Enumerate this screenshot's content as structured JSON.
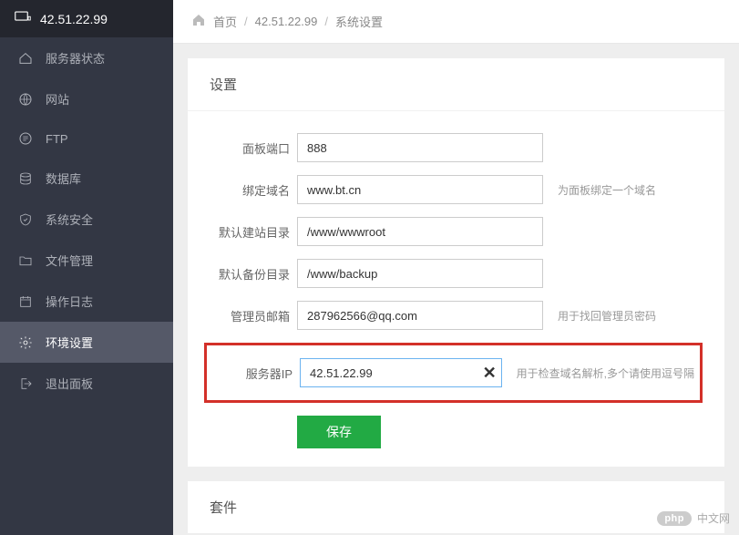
{
  "sidebar": {
    "header": {
      "ip": "42.51.22.99"
    },
    "items": [
      {
        "label": "服务器状态"
      },
      {
        "label": "网站"
      },
      {
        "label": "FTP"
      },
      {
        "label": "数据库"
      },
      {
        "label": "系统安全"
      },
      {
        "label": "文件管理"
      },
      {
        "label": "操作日志"
      },
      {
        "label": "环境设置"
      },
      {
        "label": "退出面板"
      }
    ]
  },
  "breadcrumb": {
    "home": "首页",
    "ip": "42.51.22.99",
    "current": "系统设置"
  },
  "settings": {
    "title": "设置",
    "fields": {
      "port": {
        "label": "面板端口",
        "value": "888"
      },
      "domain": {
        "label": "绑定域名",
        "value": "www.bt.cn",
        "hint": "为面板绑定一个域名"
      },
      "siteroot": {
        "label": "默认建站目录",
        "value": "/www/wwwroot"
      },
      "backupdir": {
        "label": "默认备份目录",
        "value": "/www/backup"
      },
      "adminmail": {
        "label": "管理员邮箱",
        "value": "287962566@qq.com",
        "hint": "用于找回管理员密码"
      },
      "serverip": {
        "label": "服务器IP",
        "value": "42.51.22.99",
        "hint": "用于检查域名解析,多个请使用逗号隔"
      }
    },
    "save_label": "保存"
  },
  "suite": {
    "title": "套件"
  },
  "watermark": {
    "badge": "php",
    "text": "中文网"
  }
}
